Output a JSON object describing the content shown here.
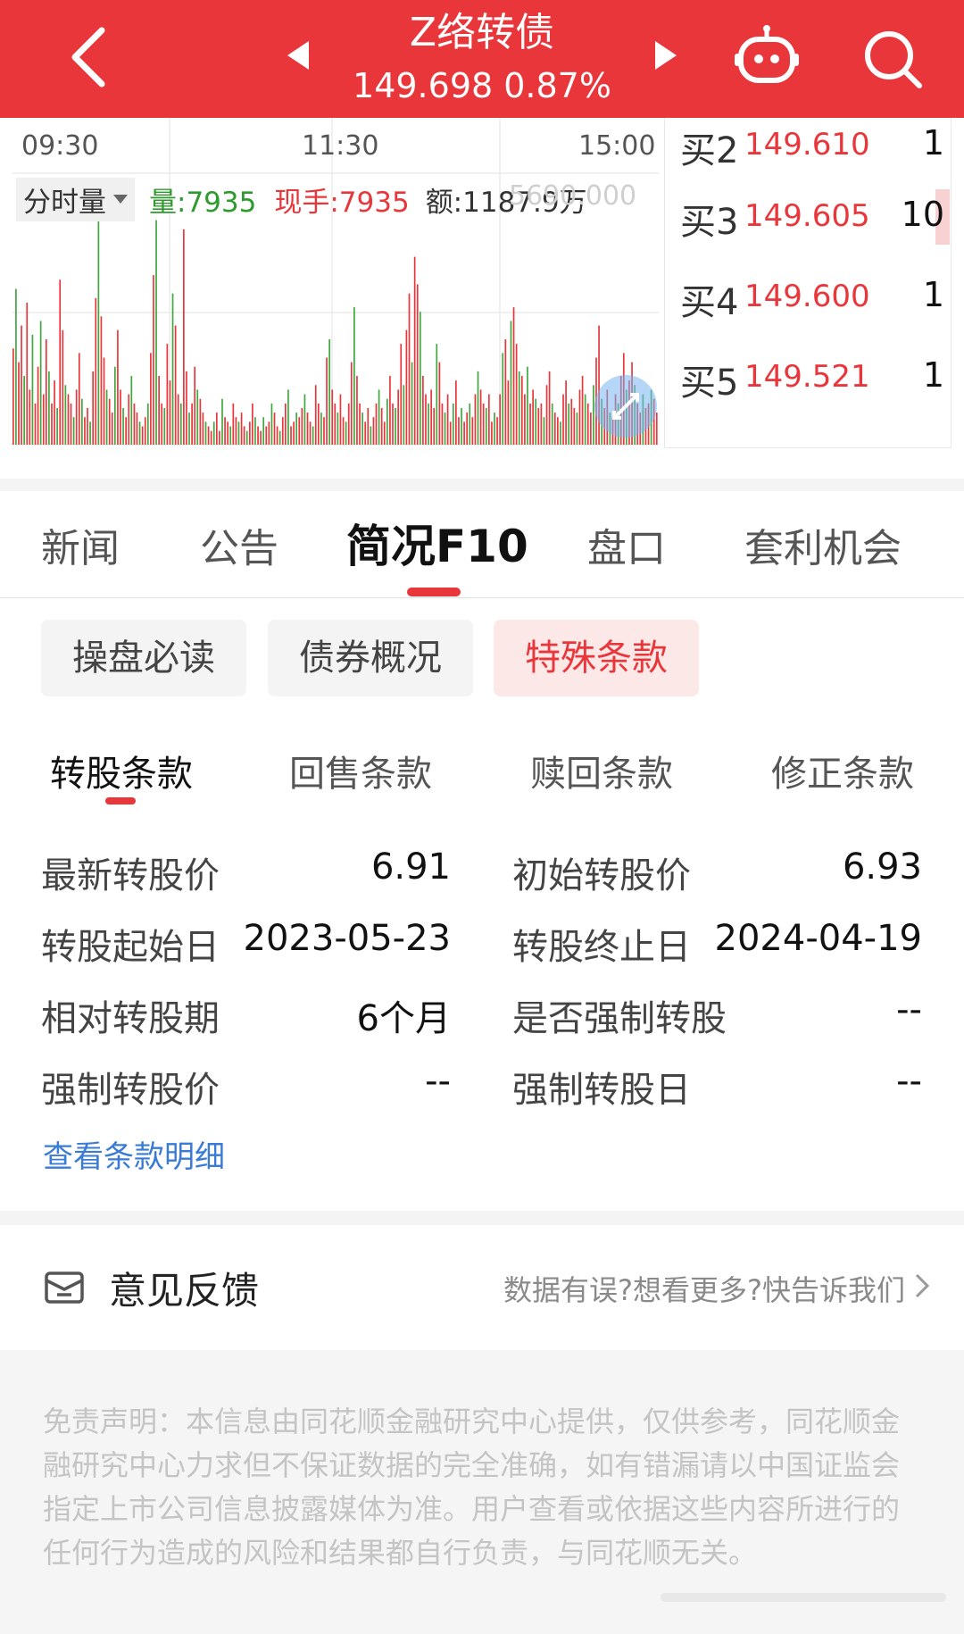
{
  "header": {
    "title": "Z络转债",
    "price_line": "149.698 0.87%",
    "brand_color": "#e8363b"
  },
  "chart": {
    "times": [
      "09:30",
      "11:30",
      "15:00"
    ],
    "volume_selector": "分时量",
    "volume_label": "量:7935",
    "current_hand_label": "现手:7935",
    "amount_label": "额:1187.9万",
    "axis_max_label": "5690.000"
  },
  "chart_data": {
    "type": "bar",
    "title": "",
    "xlabel": "",
    "ylabel": "",
    "x_ticks": [
      "09:30",
      "11:30",
      "15:00"
    ],
    "ylim": [
      0,
      5690
    ],
    "series": [
      {
        "color": "mixed",
        "values": [
          2100,
          3400,
          1800,
          2600,
          1500,
          3100,
          1200,
          2400,
          900,
          1700,
          2700,
          1100,
          2300,
          1600,
          900,
          1400,
          800,
          3600,
          2500,
          1300,
          1100,
          900,
          600,
          1200,
          2000,
          1000,
          600,
          800,
          500,
          1600,
          3200,
          5600,
          2800,
          1900,
          1200,
          1000,
          700,
          1700,
          2500,
          1200,
          800,
          600,
          1100,
          1500,
          900,
          700,
          500,
          400,
          600,
          900,
          2000,
          3700,
          4900,
          1500,
          900,
          800,
          2200,
          1400,
          3300,
          2600,
          1100,
          900,
          4700,
          1600,
          700,
          900,
          1700,
          1200,
          1000,
          700,
          500,
          400,
          300,
          500,
          700,
          300,
          1000,
          600,
          500,
          400,
          900,
          600,
          500,
          700,
          400,
          300,
          500,
          900,
          600,
          400,
          300,
          600,
          400,
          500,
          900,
          700,
          400,
          300,
          600,
          900,
          1200,
          400,
          500,
          700,
          600,
          800,
          1100,
          700,
          500,
          400,
          1300,
          900,
          700,
          600,
          1900,
          2300,
          1200,
          900,
          700,
          1100,
          600,
          500,
          900,
          1800,
          3000,
          1500,
          900,
          700,
          500,
          800,
          400,
          600,
          900,
          1200,
          800,
          500,
          1000,
          1500,
          900,
          800,
          1200,
          2200,
          1300,
          2500,
          3300,
          1800,
          4100,
          3500,
          2900,
          1500,
          1100,
          900,
          1200,
          800,
          2200,
          1800,
          900,
          700,
          1100,
          500,
          900,
          1400,
          600,
          800,
          500,
          700,
          900,
          600,
          1100,
          1600,
          1200,
          900,
          800,
          1100,
          500,
          700,
          600,
          1100,
          2000,
          2300,
          1400,
          2700,
          3000,
          2200,
          1600,
          1500,
          1100,
          1700,
          900,
          1200,
          1000,
          800,
          900,
          600,
          1300,
          1600,
          900,
          700,
          600,
          500,
          1100,
          1400,
          900,
          1000,
          800,
          700,
          1200,
          1500,
          1100,
          900,
          700,
          1300,
          1900,
          2600,
          1000,
          800,
          1200,
          700,
          600,
          1100,
          900,
          1500,
          2000,
          1200,
          1400,
          1800,
          1300,
          900,
          700,
          1100,
          800,
          900,
          1200,
          1000,
          700
        ]
      }
    ]
  },
  "order_book": [
    {
      "label": "买2",
      "price": "149.610",
      "qty": "1",
      "bar": false
    },
    {
      "label": "买3",
      "price": "149.605",
      "qty": "10",
      "bar": true
    },
    {
      "label": "买4",
      "price": "149.600",
      "qty": "1",
      "bar": false
    },
    {
      "label": "买5",
      "price": "149.521",
      "qty": "1",
      "bar": false
    }
  ],
  "main_tabs": [
    {
      "label": "新闻"
    },
    {
      "label": "公告"
    },
    {
      "label": "简况F10"
    },
    {
      "label": "盘口"
    },
    {
      "label": "套利机会"
    }
  ],
  "chips": [
    {
      "label": "操盘必读"
    },
    {
      "label": "债券概况"
    },
    {
      "label": "特殊条款"
    }
  ],
  "sub_tabs": [
    {
      "label": "转股条款"
    },
    {
      "label": "回售条款"
    },
    {
      "label": "赎回条款"
    },
    {
      "label": "修正条款"
    }
  ],
  "terms": [
    {
      "label": "最新转股价",
      "value": "6.91"
    },
    {
      "label": "初始转股价",
      "value": "6.93"
    },
    {
      "label": "转股起始日",
      "value": "2023-05-23"
    },
    {
      "label": "转股终止日",
      "value": "2024-04-19"
    },
    {
      "label": "相对转股期",
      "value": "6个月"
    },
    {
      "label": "是否强制转股",
      "value": "--"
    },
    {
      "label": "强制转股价",
      "value": "--"
    },
    {
      "label": "强制转股日",
      "value": "--"
    }
  ],
  "detail_link": "查看条款明细",
  "feedback": {
    "title": "意见反馈",
    "link": "数据有误?想看更多?快告诉我们"
  },
  "disclaimer": "免责声明：本信息由同花顺金融研究中心提供，仅供参考，同花顺金融研究中心力求但不保证数据的完全准确，如有错漏请以中国证监会指定上市公司信息披露媒体为准。用户查看或依据这些内容所进行的任何行为造成的风险和结果都自行负责，与同花顺无关。"
}
